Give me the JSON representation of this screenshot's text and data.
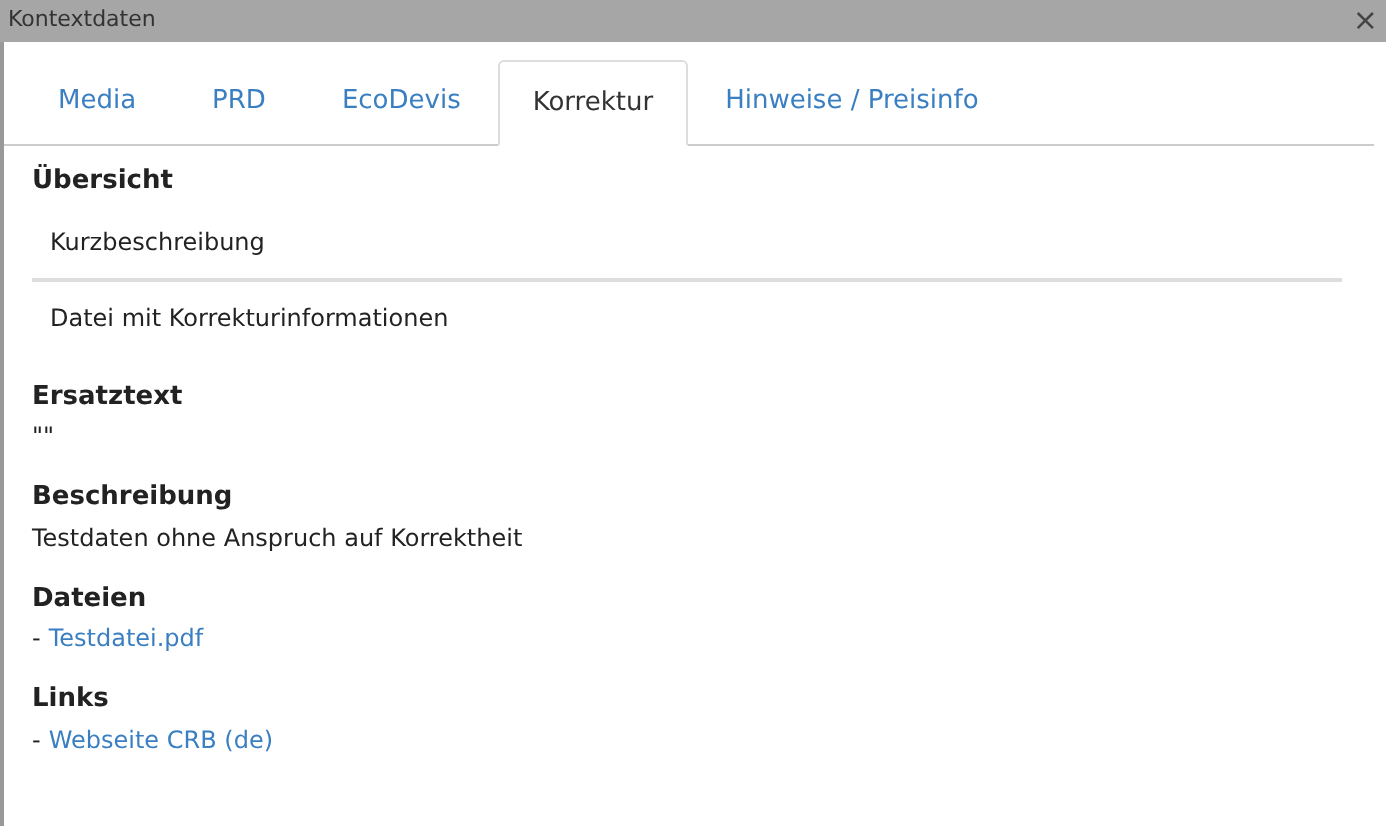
{
  "window": {
    "title": "Kontextdaten",
    "close": "×"
  },
  "tabs": [
    {
      "label": "Media",
      "selected": false
    },
    {
      "label": "PRD",
      "selected": false
    },
    {
      "label": "EcoDevis",
      "selected": false
    },
    {
      "label": "Korrektur",
      "selected": true
    },
    {
      "label": "Hinweise / Preisinfo",
      "selected": false
    }
  ],
  "overview": {
    "heading": "Übersicht",
    "rows": [
      "Kurzbeschreibung",
      "Datei mit Korrekturinformationen"
    ]
  },
  "sections": [
    {
      "kind": "text",
      "heading": "Ersatztext",
      "text": "\"\""
    },
    {
      "kind": "text",
      "heading": "Beschreibung",
      "text": "Testdaten ohne Anspruch auf Korrektheit"
    },
    {
      "kind": "links",
      "heading": "Dateien",
      "items": [
        {
          "bullet": "-",
          "label": "Testdatei.pdf"
        }
      ]
    },
    {
      "kind": "links",
      "heading": "Links",
      "items": [
        {
          "bullet": "-",
          "label": "Webseite CRB (de)"
        }
      ]
    }
  ]
}
